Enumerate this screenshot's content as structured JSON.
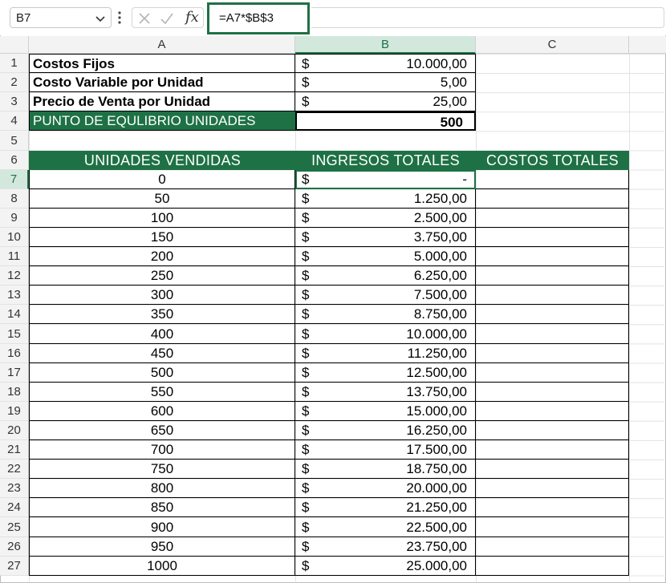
{
  "formula_bar": {
    "name_box": "B7",
    "formula": "=A7*$B$3"
  },
  "columns": [
    "A",
    "B",
    "C"
  ],
  "rows": [
    "1",
    "2",
    "3",
    "4",
    "5",
    "6",
    "7",
    "8",
    "9",
    "10",
    "11",
    "12",
    "13",
    "14",
    "15",
    "16",
    "17",
    "18",
    "19",
    "20",
    "21",
    "22",
    "23",
    "24",
    "25",
    "26",
    "27"
  ],
  "params": [
    {
      "label": "Costos Fijos",
      "currency": "$",
      "value": "10.000,00"
    },
    {
      "label": "Costo Variable por Unidad",
      "currency": "$",
      "value": "5,00"
    },
    {
      "label": "Precio de Venta por Unidad",
      "currency": "$",
      "value": "25,00"
    }
  ],
  "breakeven": {
    "label": "PUNTO DE EQULIBRIO UNIDADES",
    "value": "500"
  },
  "table_headers": [
    "UNIDADES VENDIDAS",
    "INGRESOS TOTALES",
    "COSTOS TOTALES"
  ],
  "table_rows": [
    {
      "units": "0",
      "currency": "$",
      "income": "-"
    },
    {
      "units": "50",
      "currency": "$",
      "income": "1.250,00"
    },
    {
      "units": "100",
      "currency": "$",
      "income": "2.500,00"
    },
    {
      "units": "150",
      "currency": "$",
      "income": "3.750,00"
    },
    {
      "units": "200",
      "currency": "$",
      "income": "5.000,00"
    },
    {
      "units": "250",
      "currency": "$",
      "income": "6.250,00"
    },
    {
      "units": "300",
      "currency": "$",
      "income": "7.500,00"
    },
    {
      "units": "350",
      "currency": "$",
      "income": "8.750,00"
    },
    {
      "units": "400",
      "currency": "$",
      "income": "10.000,00"
    },
    {
      "units": "450",
      "currency": "$",
      "income": "11.250,00"
    },
    {
      "units": "500",
      "currency": "$",
      "income": "12.500,00"
    },
    {
      "units": "550",
      "currency": "$",
      "income": "13.750,00"
    },
    {
      "units": "600",
      "currency": "$",
      "income": "15.000,00"
    },
    {
      "units": "650",
      "currency": "$",
      "income": "16.250,00"
    },
    {
      "units": "700",
      "currency": "$",
      "income": "17.500,00"
    },
    {
      "units": "750",
      "currency": "$",
      "income": "18.750,00"
    },
    {
      "units": "800",
      "currency": "$",
      "income": "20.000,00"
    },
    {
      "units": "850",
      "currency": "$",
      "income": "21.250,00"
    },
    {
      "units": "900",
      "currency": "$",
      "income": "22.500,00"
    },
    {
      "units": "950",
      "currency": "$",
      "income": "23.750,00"
    },
    {
      "units": "1000",
      "currency": "$",
      "income": "25.000,00"
    }
  ],
  "colors": {
    "accent": "#1e7145"
  }
}
